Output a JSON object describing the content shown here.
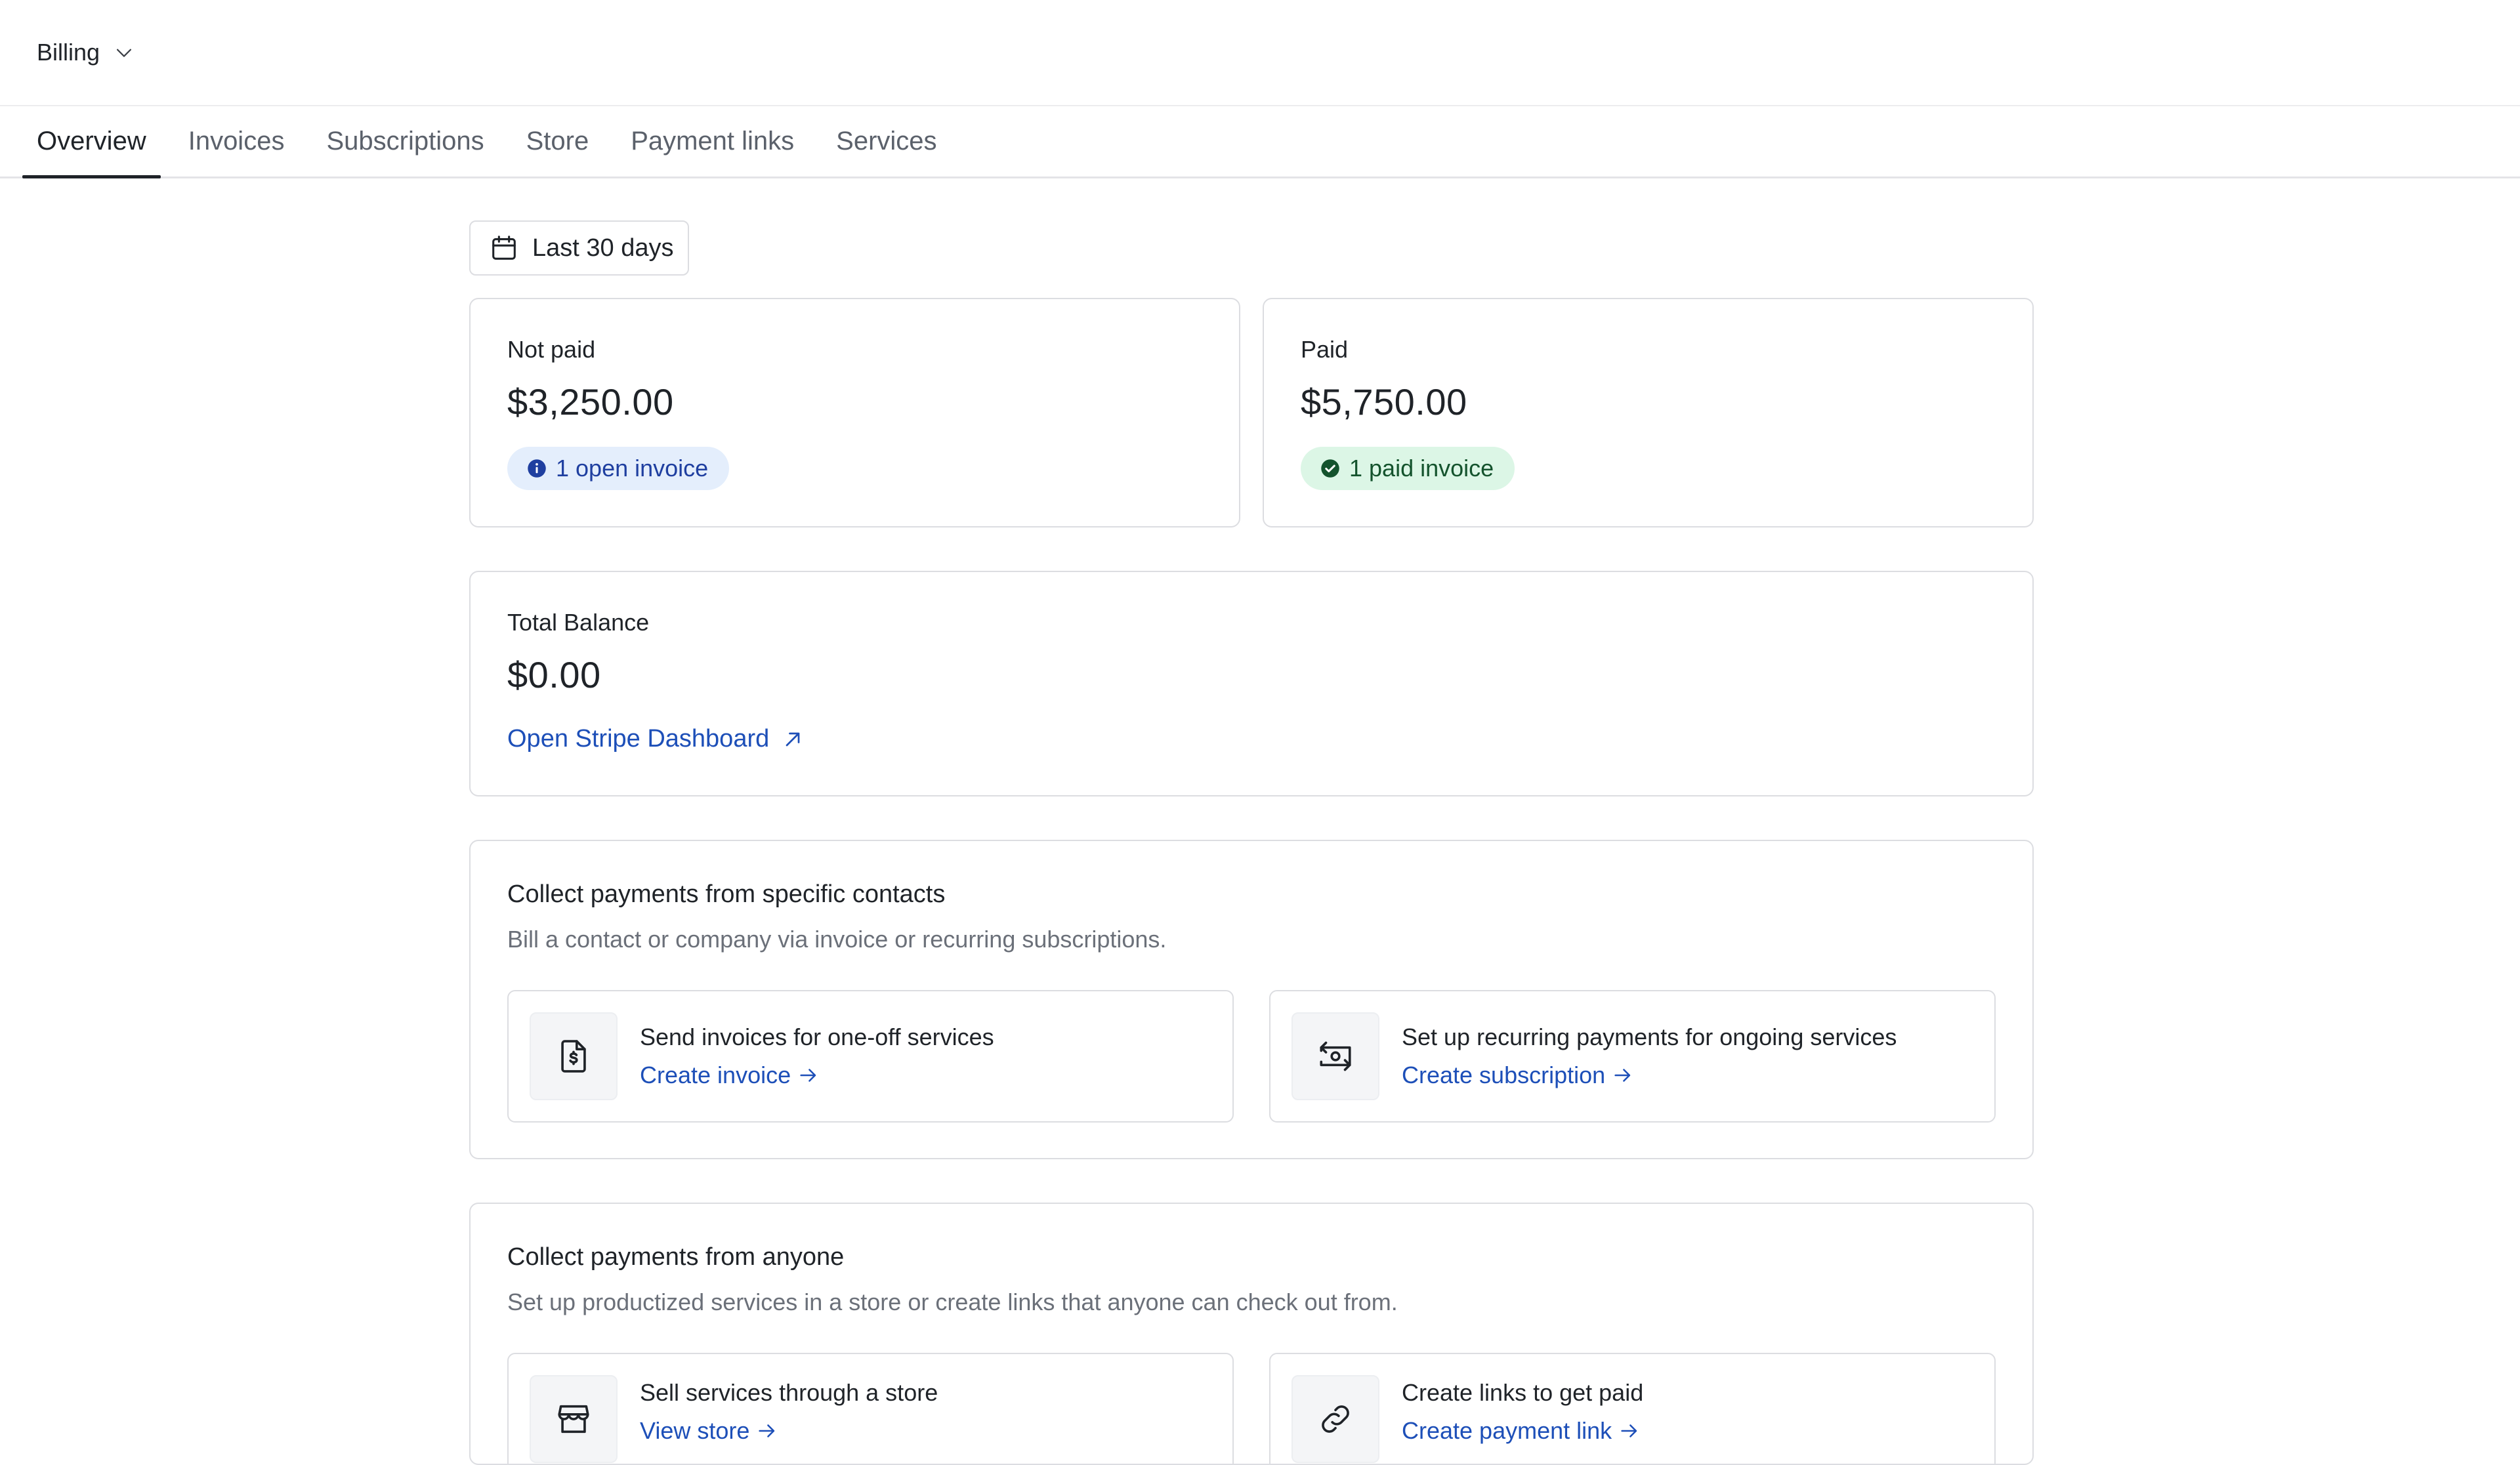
{
  "header": {
    "workspace_label": "Billing"
  },
  "tabs": [
    {
      "label": "Overview",
      "active": true
    },
    {
      "label": "Invoices",
      "active": false
    },
    {
      "label": "Subscriptions",
      "active": false
    },
    {
      "label": "Store",
      "active": false
    },
    {
      "label": "Payment links",
      "active": false
    },
    {
      "label": "Services",
      "active": false
    }
  ],
  "date_range": {
    "label": "Last 30 days",
    "icon": "calendar-icon"
  },
  "stats": {
    "not_paid": {
      "label": "Not paid",
      "value": "$3,250.00",
      "badge": "1 open invoice",
      "badge_icon": "info-icon",
      "badge_color": "#1f3fa0"
    },
    "paid": {
      "label": "Paid",
      "value": "$5,750.00",
      "badge": "1 paid invoice",
      "badge_icon": "check-circle-icon",
      "badge_color": "#14532d"
    }
  },
  "balance": {
    "label": "Total Balance",
    "value": "$0.00",
    "link": "Open Stripe Dashboard",
    "link_icon": "external-arrow-icon"
  },
  "collect_specific": {
    "title": "Collect payments from specific contacts",
    "description": "Bill a contact or company via invoice or recurring subscriptions.",
    "options": [
      {
        "title": "Send invoices for one-off services",
        "link": "Create invoice",
        "icon": "invoice-dollar-icon"
      },
      {
        "title": "Set up recurring payments for ongoing services",
        "link": "Create subscription",
        "icon": "recurring-payment-icon"
      }
    ]
  },
  "collect_anyone": {
    "title": "Collect payments from anyone",
    "description": "Set up productized services in a store or create links that anyone can check out from.",
    "options": [
      {
        "title": "Sell services through a store",
        "link": "View store",
        "icon": "store-icon"
      },
      {
        "title": "Create links to get paid",
        "link": "Create payment link",
        "icon": "link-icon"
      }
    ]
  },
  "colors": {
    "accent_link": "#1d4fb8",
    "border": "#dcdde1",
    "open_badge_bg": "#e4eefc",
    "paid_badge_bg": "#dcf6e6"
  }
}
